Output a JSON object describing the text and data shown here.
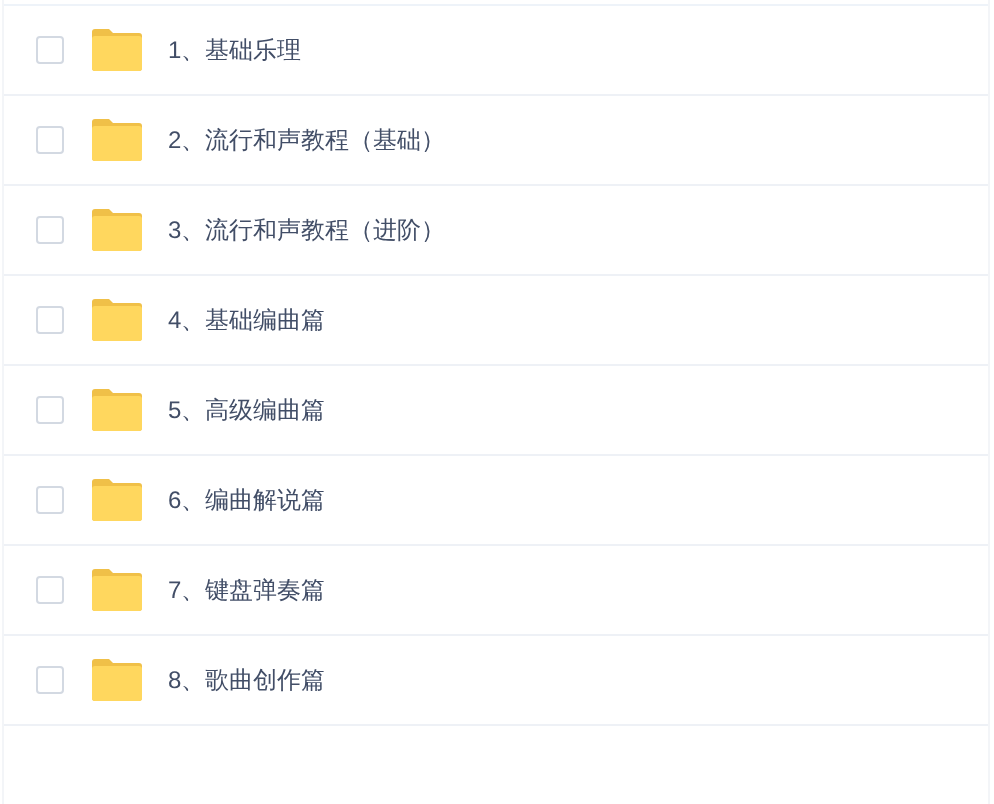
{
  "files": [
    {
      "name": "1、基础乐理",
      "checked": false
    },
    {
      "name": "2、流行和声教程（基础）",
      "checked": false
    },
    {
      "name": "3、流行和声教程（进阶）",
      "checked": false
    },
    {
      "name": "4、基础编曲篇",
      "checked": false
    },
    {
      "name": "5、高级编曲篇",
      "checked": false
    },
    {
      "name": "6、编曲解说篇",
      "checked": false
    },
    {
      "name": "7、键盘弹奏篇",
      "checked": false
    },
    {
      "name": "8、歌曲创作篇",
      "checked": false
    }
  ]
}
